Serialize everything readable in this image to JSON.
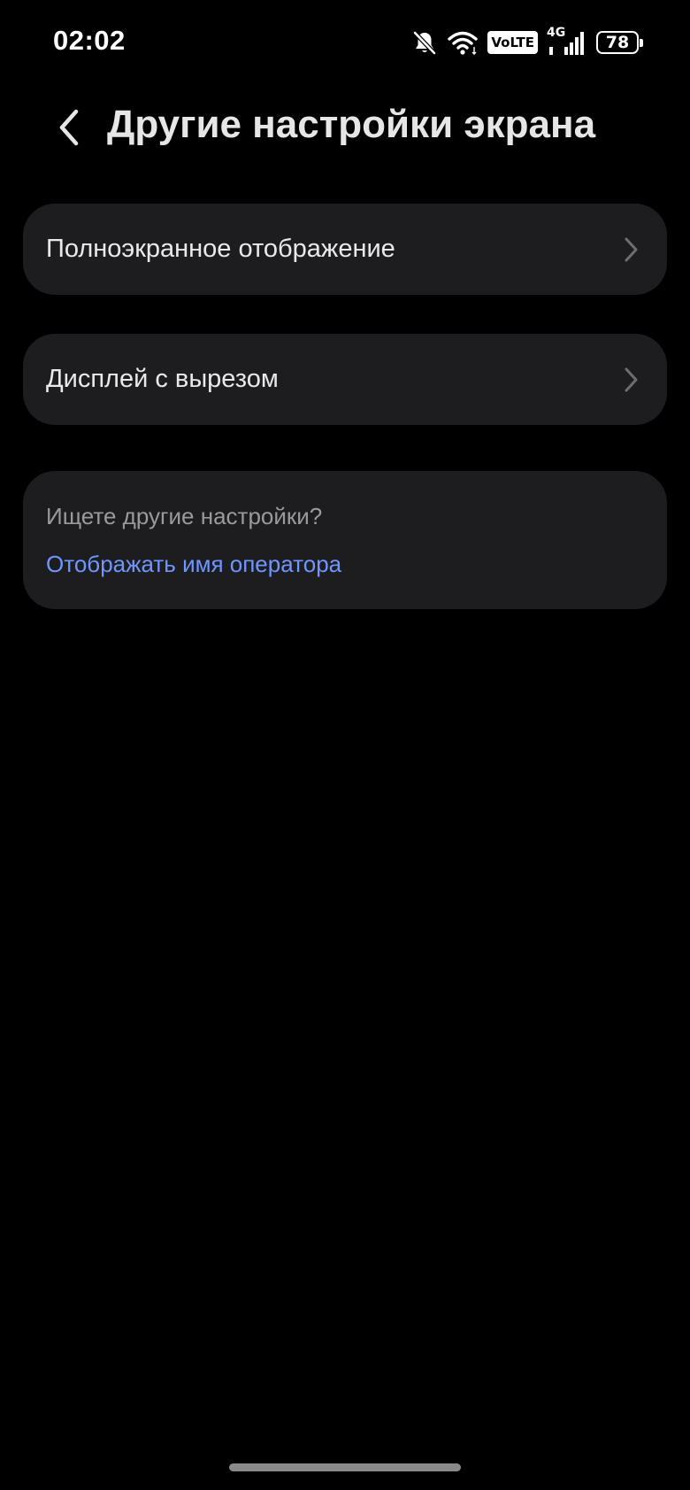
{
  "status_bar": {
    "time": "02:02",
    "volte_label": "VoLTE",
    "network_type": "4G",
    "battery_level": "78",
    "icons": [
      "bell-muted-icon",
      "wifi-icon",
      "volte-badge",
      "cellular-signal-icon",
      "battery-icon"
    ]
  },
  "header": {
    "title": "Другие настройки экрана",
    "back_icon": "chevron-left-icon"
  },
  "menu": {
    "items": [
      {
        "label": "Полноэкранное отображение",
        "icon": "chevron-right-icon"
      },
      {
        "label": "Дисплей с вырезом",
        "icon": "chevron-right-icon"
      }
    ]
  },
  "suggestions": {
    "title": "Ищете другие настройки?",
    "link": "Отображать имя оператора"
  },
  "colors": {
    "background": "#000000",
    "card": "#1d1d1f",
    "text_primary": "#e9e9e9",
    "text_secondary": "#9a9a9a",
    "link": "#6f95ff",
    "chevron": "#6e6e70"
  }
}
